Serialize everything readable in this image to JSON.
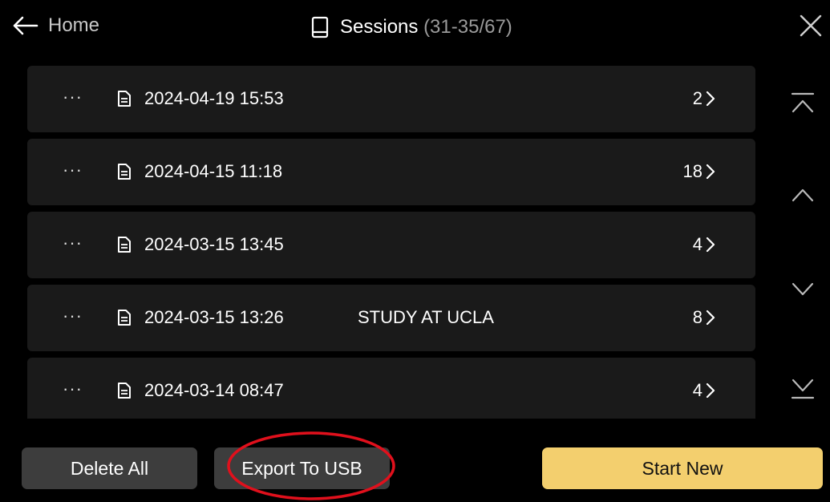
{
  "header": {
    "back_label": "Home",
    "title": "Sessions",
    "title_range": "(31-35/67)"
  },
  "sessions": [
    {
      "date": "2024-04-19 15:53",
      "note": "",
      "count": "2"
    },
    {
      "date": "2024-04-15 11:18",
      "note": "",
      "count": "18"
    },
    {
      "date": "2024-03-15 13:45",
      "note": "",
      "count": "4"
    },
    {
      "date": "2024-03-15 13:26",
      "note": "STUDY AT UCLA",
      "count": "8"
    },
    {
      "date": "2024-03-14 08:47",
      "note": "",
      "count": "4"
    }
  ],
  "row_menu_glyph": "···",
  "footer": {
    "delete_all_label": "Delete All",
    "export_label": "Export To USB",
    "start_new_label": "Start New"
  },
  "colors": {
    "background": "#000000",
    "row_bg": "#1a1a1a",
    "button_bg": "#3d3d3d",
    "accent": "#f3cf6e",
    "annotation": "#e0101c"
  }
}
